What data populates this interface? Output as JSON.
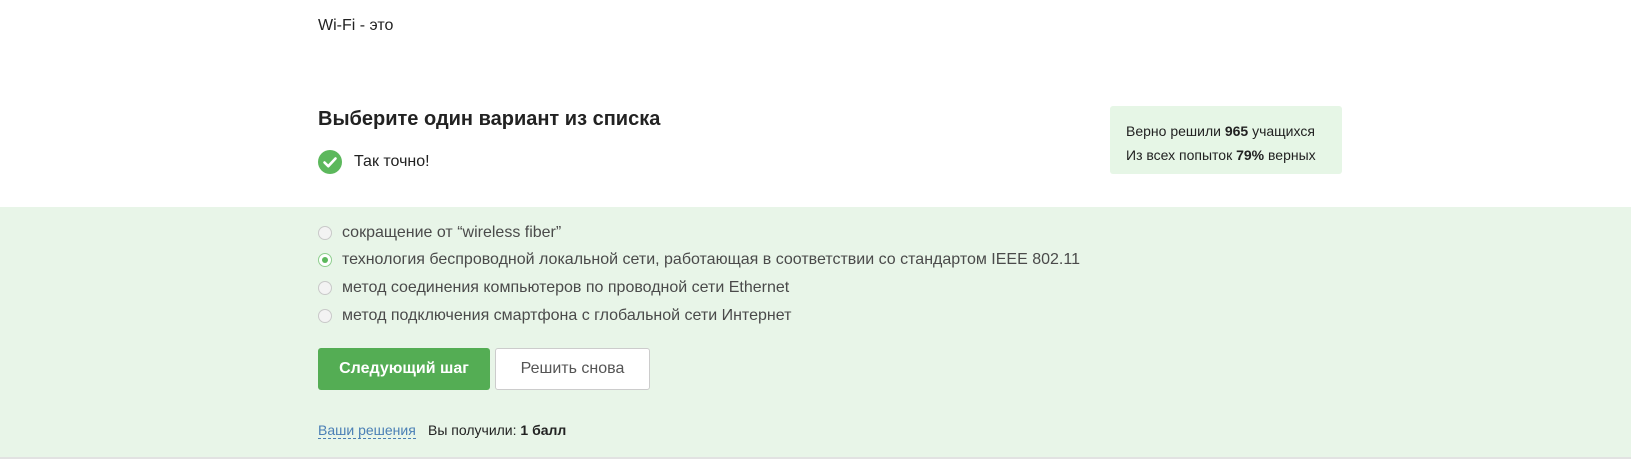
{
  "question": {
    "text": "Wi-Fi - это"
  },
  "instruction": "Выберите один вариант из списка",
  "feedback": {
    "text": "Так точно!",
    "icon": "checkmark-circle-icon",
    "color": "#5cb85c"
  },
  "stats": {
    "line1_prefix": "Верно решили",
    "line1_value": "965",
    "line1_suffix": "учащихся",
    "line2_prefix": "Из всех попыток",
    "line2_value": "79%",
    "line2_suffix": "верных"
  },
  "options": [
    {
      "label": "сокращение от “wireless fiber”",
      "selected": false
    },
    {
      "label": "технология беспроводной локальной сети, работающая в соответствии со стандартом IEEE 802.11",
      "selected": true
    },
    {
      "label": "метод соединения компьютеров по проводной сети Ethernet",
      "selected": false
    },
    {
      "label": "метод подключения смартфона с глобальной сети Интернет",
      "selected": false
    }
  ],
  "buttons": {
    "next_label": "Следующий шаг",
    "retry_label": "Решить снова"
  },
  "footer": {
    "solutions_link": "Ваши решения",
    "score_prefix": "Вы получили:",
    "score_value": "1 балл"
  },
  "colors": {
    "accent": "#54ad54",
    "panel_bg": "#e8f5e8",
    "stats_bg": "#e6f6e6",
    "link": "#4a7fb5"
  }
}
